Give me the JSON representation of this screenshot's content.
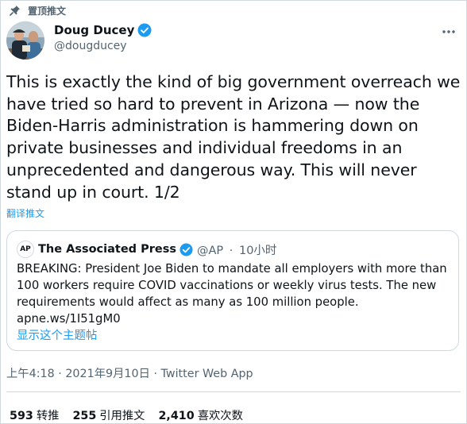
{
  "pinned_label": "置顶推文",
  "author": {
    "name": "Doug Ducey",
    "handle": "@dougducey"
  },
  "tweet_lines": [
    "This is exactly the kind of big government overreach we",
    "have tried so hard to prevent in Arizona — now the",
    "Biden-Harris administration is hammering down on",
    "private businesses and individual freedoms in an",
    "unprecedented and dangerous way. This will never",
    "stand up in court. 1/2"
  ],
  "translate_label": "翻译推文",
  "quote": {
    "logo_text": "AP",
    "name": "The Associated Press",
    "handle": "@AP",
    "separator": "·",
    "time": "10小时",
    "text_lines": [
      "BREAKING: President Joe Biden to mandate all employers with more than",
      "100 workers require COVID vaccinations or weekly virus tests. The new",
      "requirements would affect as many as 100 million people.",
      "apne.ws/1I51gM0"
    ],
    "show_thread": "显示这个主题帖"
  },
  "timestamp": "上午4:18 · 2021年9月10日 · Twitter Web App",
  "stats": [
    {
      "count": "593",
      "label": "转推"
    },
    {
      "count": "255",
      "label": "引用推文"
    },
    {
      "count": "2,410",
      "label": "喜欢次数"
    }
  ],
  "colors": {
    "accent": "#1d9bf0",
    "secondary_text": "#536471",
    "border": "#cfd9de"
  },
  "icons": [
    "pin-icon",
    "verified-badge-icon",
    "more-options-icon"
  ]
}
